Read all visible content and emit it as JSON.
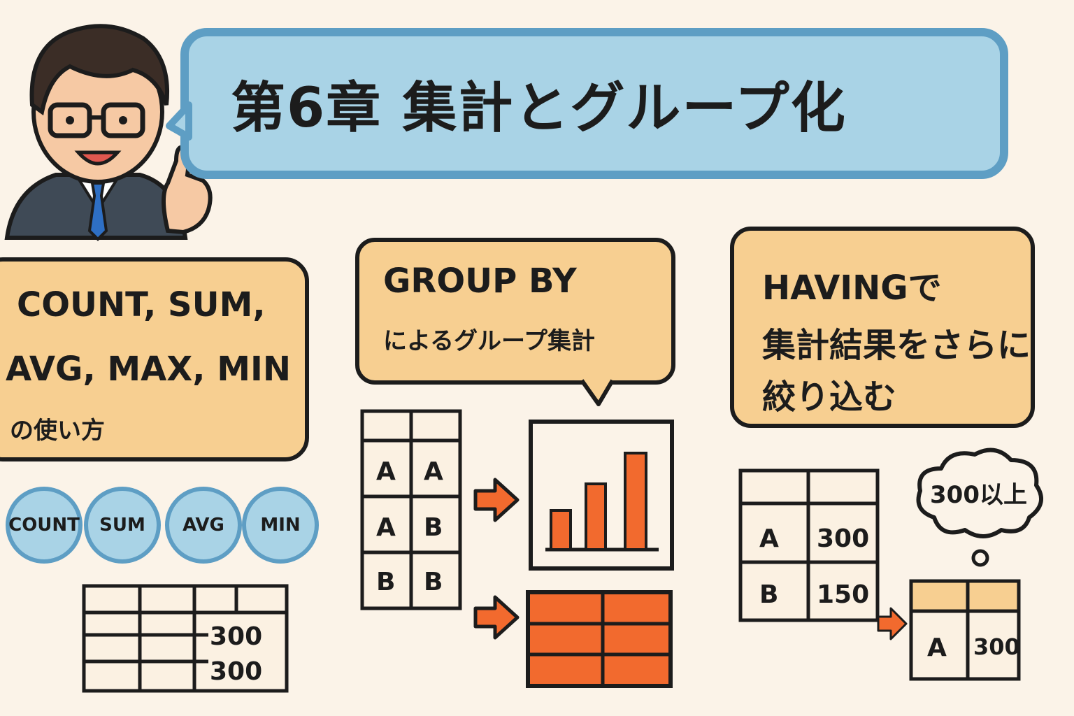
{
  "title": "第6章 集計とグループ化",
  "aggregate_section": {
    "heading_line1": "COUNT, SUM,",
    "heading_line2": "AVG, MAX, MIN",
    "heading_line3": "の使い方",
    "functions": [
      "COUNT",
      "SUM",
      "AVG",
      "MIN"
    ],
    "table_values": [
      "300",
      "300"
    ]
  },
  "groupby_section": {
    "heading_line1": "GROUP BY",
    "heading_line2": "によるグループ集計",
    "table_rows": [
      [
        "A",
        "A"
      ],
      [
        "A",
        "B"
      ],
      [
        "B",
        "B"
      ]
    ]
  },
  "having_section": {
    "heading_line1": "HAVINGで",
    "heading_line2": "集計結果をさらに",
    "heading_line3": "絞り込む",
    "thought": "300以上",
    "table_rows": [
      [
        "A",
        "300"
      ],
      [
        "B",
        "150"
      ]
    ],
    "result_row": [
      "A",
      "300"
    ]
  },
  "colors": {
    "background": "#fbf3e8",
    "blue_fill": "#a9d3e6",
    "blue_border": "#5e9ec4",
    "orange_fill": "#f7cf91",
    "accent_orange": "#f26a2e"
  }
}
